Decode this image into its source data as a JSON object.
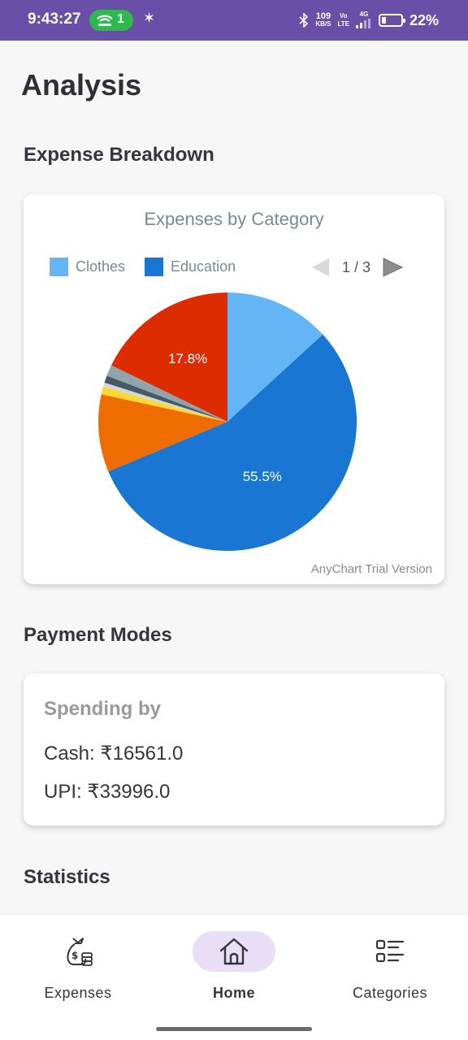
{
  "status_bar": {
    "time": "9:43:27",
    "hotspot_count": "1",
    "net_speed_value": "109",
    "net_speed_unit": "KB/S",
    "volte_top": "Vo",
    "volte_bottom": "LTE",
    "network": "4G",
    "battery_percent": "22%",
    "battery_level": 0.22,
    "bg_color": "#6a4fa8"
  },
  "page": {
    "title": "Analysis"
  },
  "expense_breakdown": {
    "section_title": "Expense Breakdown",
    "watermark": "AnyChart Trial Version",
    "pager_text": "1 / 3",
    "chart_data": {
      "type": "pie",
      "title": "Expenses by Category",
      "legend_position": "top-left",
      "legend": [
        {
          "name": "Clothes",
          "color": "#64b5f6"
        },
        {
          "name": "Education",
          "color": "#1976d2"
        }
      ],
      "slices": [
        {
          "name": "Clothes",
          "value": 13.2,
          "color": "#64b5f6"
        },
        {
          "name": "Education",
          "value": 55.5,
          "color": "#1976d2",
          "label": "55.5%"
        },
        {
          "name": "",
          "value": 9.7,
          "color": "#ef6c00"
        },
        {
          "name": "",
          "value": 1.0,
          "color": "#fdd835"
        },
        {
          "name": "",
          "value": 0.5,
          "color": "#cfd8dc"
        },
        {
          "name": "",
          "value": 0.9,
          "color": "#455a64"
        },
        {
          "name": "",
          "value": 1.4,
          "color": "#90a4ae"
        },
        {
          "name": "",
          "value": 17.8,
          "color": "#dd2c00",
          "label": "17.8%"
        }
      ]
    }
  },
  "payment_modes": {
    "section_title": "Payment Modes",
    "heading": "Spending by",
    "cash": "Cash: ₹16561.0",
    "upi": "UPI: ₹33996.0"
  },
  "statistics": {
    "section_title": "Statistics"
  },
  "bottom_nav": {
    "items": [
      {
        "label": "Expenses",
        "icon": "money-bag-icon",
        "active": false
      },
      {
        "label": "Home",
        "icon": "home-icon",
        "active": true
      },
      {
        "label": "Categories",
        "icon": "list-icon",
        "active": false
      }
    ],
    "active_bg": "#e8dff6"
  }
}
